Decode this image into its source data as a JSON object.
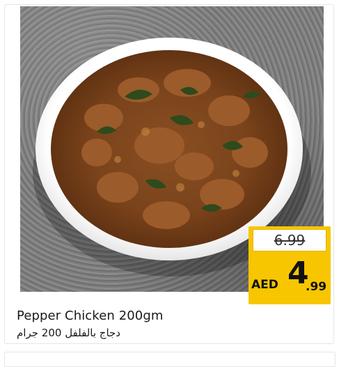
{
  "product": {
    "name_en": "Pepper Chicken 200gm",
    "name_ar": "دجاج بالفلفل 200 جرام"
  },
  "price": {
    "old": "6.99",
    "currency": "AED",
    "integer": "4",
    "decimal": ".99"
  },
  "colors": {
    "badge": "#f7c600",
    "text": "#1a1a1a"
  }
}
